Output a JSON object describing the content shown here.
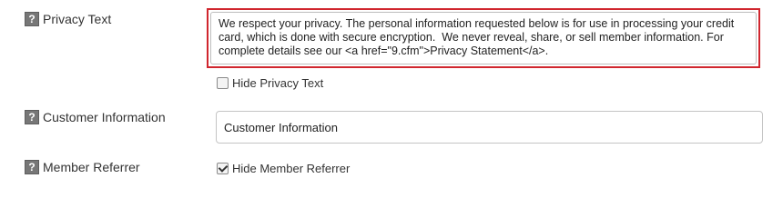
{
  "fields": {
    "privacy_text": {
      "help_label": "?",
      "label": "Privacy Text",
      "value": "We respect your privacy. The personal information requested below is for use in processing your credit card, which is done with secure encryption.  We never reveal, share, or sell member information. For complete details see our <a href=\"9.cfm\">Privacy Statement</a>.",
      "hide_label": "Hide Privacy Text",
      "hide_checked": false
    },
    "customer_information": {
      "help_label": "?",
      "label": "Customer Information",
      "value": "Customer Information"
    },
    "member_referrer": {
      "help_label": "?",
      "label": "Member Referrer",
      "hide_label": "Hide Member Referrer",
      "hide_checked": true
    }
  },
  "colors": {
    "focus_highlight": "#d0262e",
    "help_icon_bg": "#777777"
  }
}
